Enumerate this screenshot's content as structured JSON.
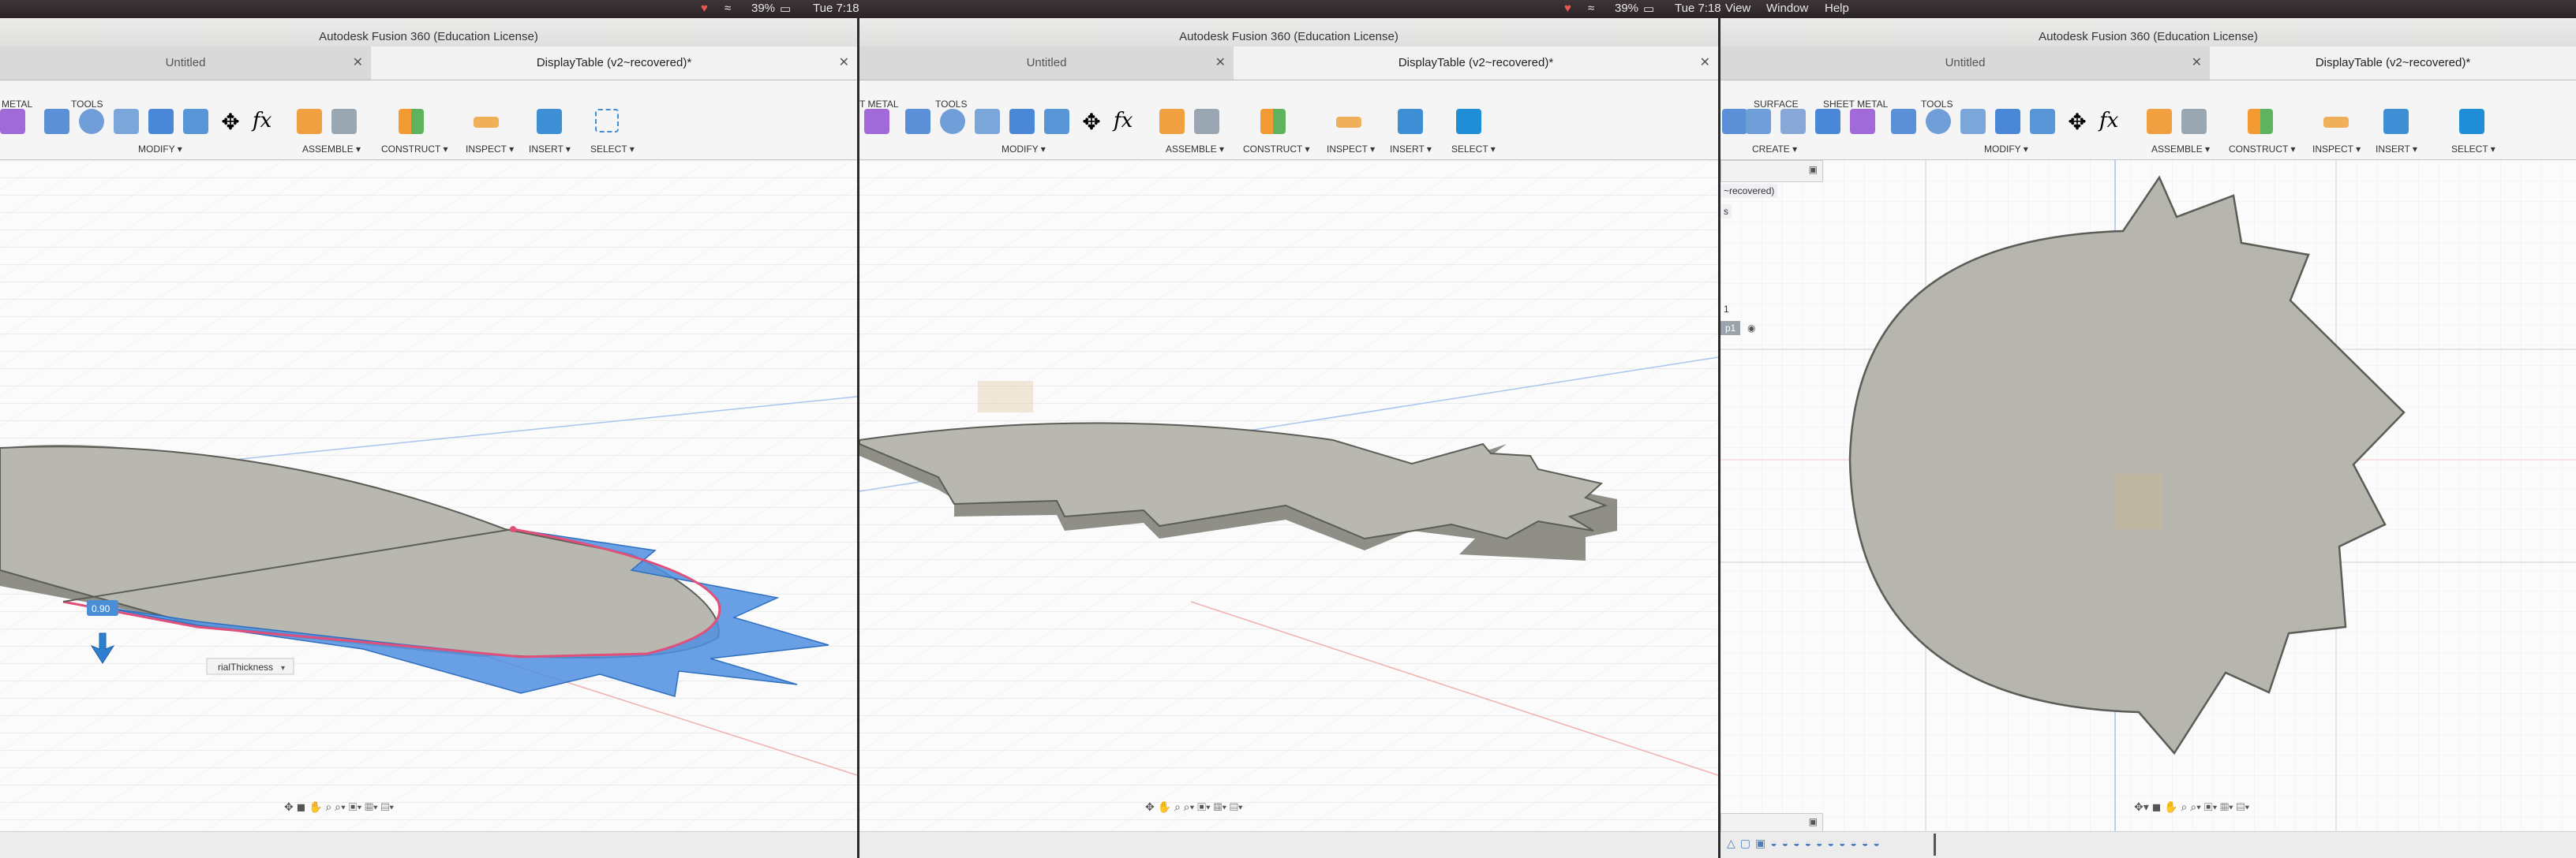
{
  "menubar": {
    "battery": "39%",
    "pane1_clock": "Tue 7:18",
    "pane2_clock": "Tue 7:18",
    "menu_view": "View",
    "menu_window": "Window",
    "menu_help": "Help"
  },
  "window_title": "Autodesk Fusion 360 (Education License)",
  "tabs": {
    "untitled": "Untitled",
    "document": "DisplayTable (v2~recovered)*"
  },
  "toolbar": {
    "pane1_top": {
      "metal": "METAL",
      "tools": "TOOLS"
    },
    "pane2_top": {
      "metal": "T METAL",
      "tools": "TOOLS"
    },
    "pane3_top": {
      "surface": "SURFACE",
      "sheet_metal": "SHEET METAL",
      "tools": "TOOLS"
    },
    "create": "CREATE",
    "modify": "MODIFY",
    "assemble": "ASSEMBLE",
    "construct": "CONSTRUCT",
    "inspect": "INSPECT",
    "insert": "INSERT",
    "select": "SELECT",
    "fx": "fx"
  },
  "pane1": {
    "dimension_value": "0.90",
    "param_dropdown": "rialThickness"
  },
  "pane3": {
    "browser_doc": "~recovered)",
    "browser_item_a": "s",
    "browser_item_b": "1",
    "browser_item_c": "p1"
  },
  "colors": {
    "body_fill": "#b7b6ae",
    "body_fill_light": "#c4c4bd",
    "body_edge": "#5d5d57",
    "side_face": "#8e8d86",
    "preview_blue": "#4f8fe0",
    "selection_pink": "#e0507a",
    "grid_line": "#dddddd",
    "accent": "#1e8fd6"
  },
  "icons": [
    "apple-icon",
    "battery-icon",
    "wifi-icon",
    "cloud-icon",
    "x-close-icon",
    "fx-icon",
    "move-icon",
    "zoom-icon",
    "pan-icon",
    "orbit-icon"
  ]
}
